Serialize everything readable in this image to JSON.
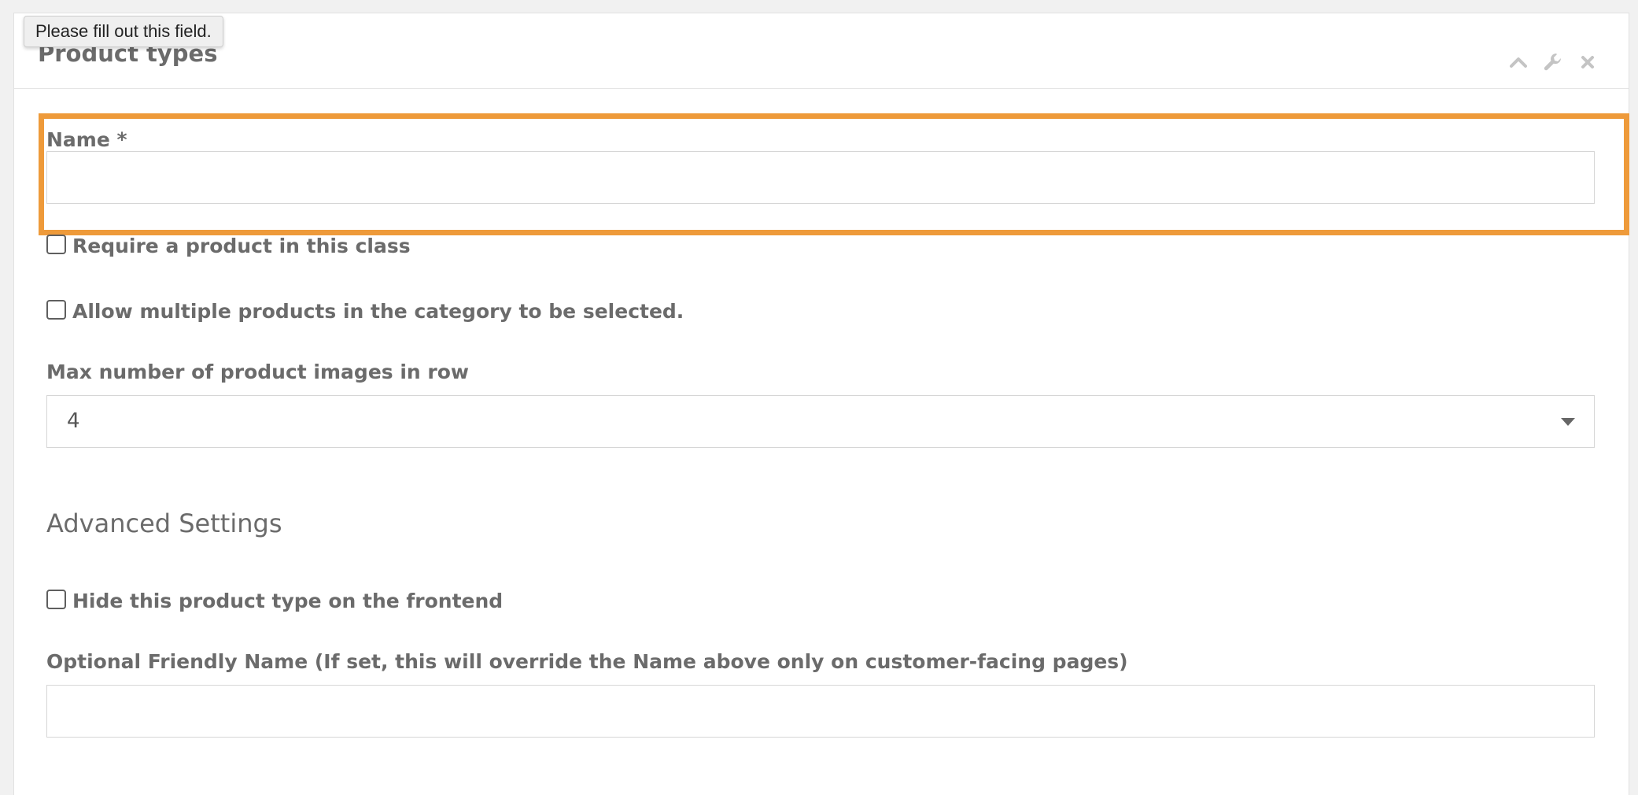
{
  "tooltip": {
    "text": "Please fill out this field."
  },
  "panel": {
    "title": "Product types",
    "icons": [
      "chevron-up-icon",
      "wrench-icon",
      "close-icon"
    ]
  },
  "form": {
    "name_label": "Name *",
    "name_value": "",
    "require_product_label": "Require a product in this class",
    "allow_multiple_label": "Allow multiple products in the category to be selected.",
    "max_images_label": "Max number of product images in row",
    "max_images_value": "4",
    "advanced_heading": "Advanced Settings",
    "hide_frontend_label": "Hide this product type on the frontend",
    "friendly_name_label": "Optional Friendly Name (If set, this will override the Name above only on customer-facing pages)",
    "friendly_name_value": ""
  },
  "colors": {
    "highlight": "#ee9a3a",
    "text": "#6b6b6b",
    "background": "#f1f1f1"
  }
}
